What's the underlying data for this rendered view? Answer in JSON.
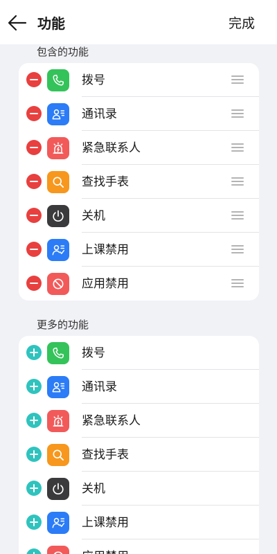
{
  "header": {
    "title": "功能",
    "done_label": "完成"
  },
  "included": {
    "title": "包含的功能",
    "items": [
      {
        "label": "拨号",
        "icon": "phone-icon",
        "color": "#34c35a"
      },
      {
        "label": "通讯录",
        "icon": "contacts-icon",
        "color": "#2b7cf6"
      },
      {
        "label": "紧急联系人",
        "icon": "emergency-alarm-icon",
        "color": "#f25a5a"
      },
      {
        "label": "查找手表",
        "icon": "find-watch-icon",
        "color": "#f7971d"
      },
      {
        "label": "关机",
        "icon": "power-icon",
        "color": "#3a3a3c"
      },
      {
        "label": "上课禁用",
        "icon": "class-disable-icon",
        "color": "#2b7cf6"
      },
      {
        "label": "应用禁用",
        "icon": "app-disable-icon",
        "color": "#f25a5a"
      }
    ]
  },
  "more": {
    "title": "更多的功能",
    "items": [
      {
        "label": "拨号",
        "icon": "phone-icon",
        "color": "#34c35a"
      },
      {
        "label": "通讯录",
        "icon": "contacts-icon",
        "color": "#2b7cf6"
      },
      {
        "label": "紧急联系人",
        "icon": "emergency-alarm-icon",
        "color": "#f25a5a"
      },
      {
        "label": "查找手表",
        "icon": "find-watch-icon",
        "color": "#f7971d"
      },
      {
        "label": "关机",
        "icon": "power-icon",
        "color": "#3a3a3c"
      },
      {
        "label": "上课禁用",
        "icon": "class-disable-icon",
        "color": "#2b7cf6"
      },
      {
        "label": "应用禁用",
        "icon": "app-disable-icon",
        "color": "#f25a5a"
      }
    ]
  },
  "colors": {
    "remove": "#e8403f",
    "add": "#2fc3be",
    "background": "#f1f2f6"
  }
}
